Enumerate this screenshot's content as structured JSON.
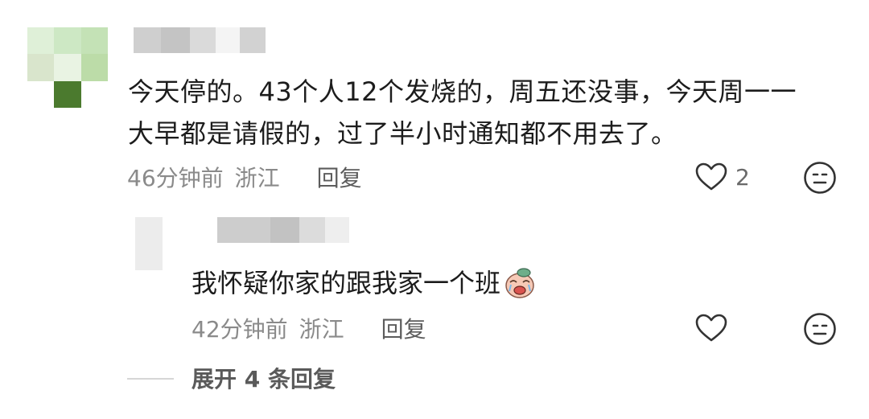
{
  "main_comment": {
    "text_line1": "今天停的。43个人12个发烧的，周五还没事，今天周一一",
    "text_line2": "大早都是请假的，过了半小时通知都不用去了。",
    "time": "46分钟前",
    "location": "浙江",
    "reply_label": "回复",
    "like_count": "2",
    "avatar_colors": [
      "#dff0d8",
      "#cde8c4",
      "#c4e2b6",
      "#d9e5cc",
      "#e9f3e3",
      "#bcdca8",
      "#ffffff",
      "#4b7a2e",
      "#ffffff"
    ]
  },
  "reply_comment": {
    "text": "我怀疑你家的跟我家一个班",
    "time": "42分钟前",
    "location": "浙江",
    "reply_label": "回复"
  },
  "expand": {
    "label": "展开 4 条回复"
  }
}
